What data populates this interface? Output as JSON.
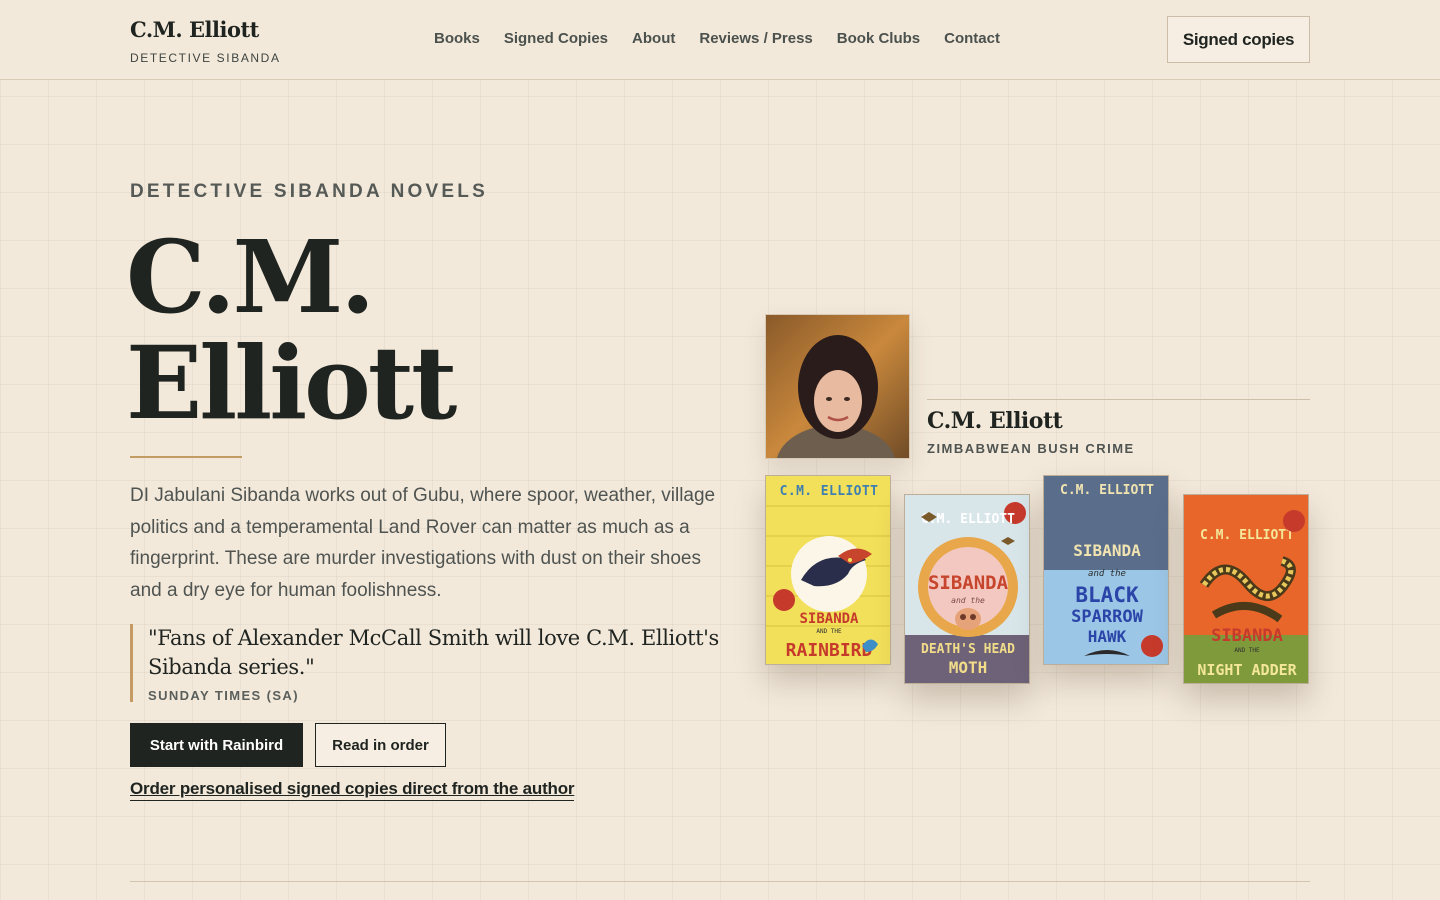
{
  "header": {
    "brand_name": "C.M. Elliott",
    "brand_tag": "DETECTIVE SIBANDA",
    "nav": [
      "Books",
      "Signed Copies",
      "About",
      "Reviews / Press",
      "Book Clubs",
      "Contact"
    ],
    "cta_label": "Signed copies"
  },
  "hero": {
    "kicker": "DETECTIVE SIBANDA NOVELS",
    "title_line1": "C.M.",
    "title_line2": "Elliott",
    "lede": "DI Jabulani Sibanda works out of Gubu, where spoor, weather, village politics and a temperamental Land Rover can matter as much as a fingerprint. These are murder investigations with dust on their shoes and a dry eye for human foolishness.",
    "quote_text": "\"Fans of Alexander McCall Smith will love C.M. Elliott's Sibanda series.\"",
    "quote_source": "SUNDAY TIMES (SA)",
    "primary_button": "Start with Rainbird",
    "secondary_button": "Read in order",
    "signed_link": "Order personalised signed copies direct from the author"
  },
  "author_card": {
    "name": "C.M. Elliott",
    "tagline": "ZIMBABWEAN BUSH CRIME"
  },
  "books": [
    {
      "author": "C.M. ELLIOTT",
      "series": "SIBANDA",
      "joiner": "AND THE",
      "title": "RAINBIRD",
      "bg": "#f2e05a",
      "accent": "#c63a2c"
    },
    {
      "author": "C.M. ELLIOTT",
      "series": "SIBANDA",
      "joiner": "and the",
      "title_line1": "DEATH'S HEAD",
      "title_line2": "MOTH",
      "bg": "#d8e6ea",
      "accent": "#e8a74a"
    },
    {
      "author": "C.M. ELLIOTT",
      "series": "SIBANDA",
      "joiner": "and the",
      "title_line1": "BLACK",
      "title_line2": "SPARROW",
      "title_line3": "HAWK",
      "bg": "#5a6e8c",
      "accent": "#2a44a8"
    },
    {
      "author": "C.M. ELLIOTT",
      "series": "SIBANDA",
      "joiner": "AND THE",
      "title": "NIGHT ADDER",
      "bg": "#7e9a3a",
      "accent": "#e8662a"
    }
  ]
}
